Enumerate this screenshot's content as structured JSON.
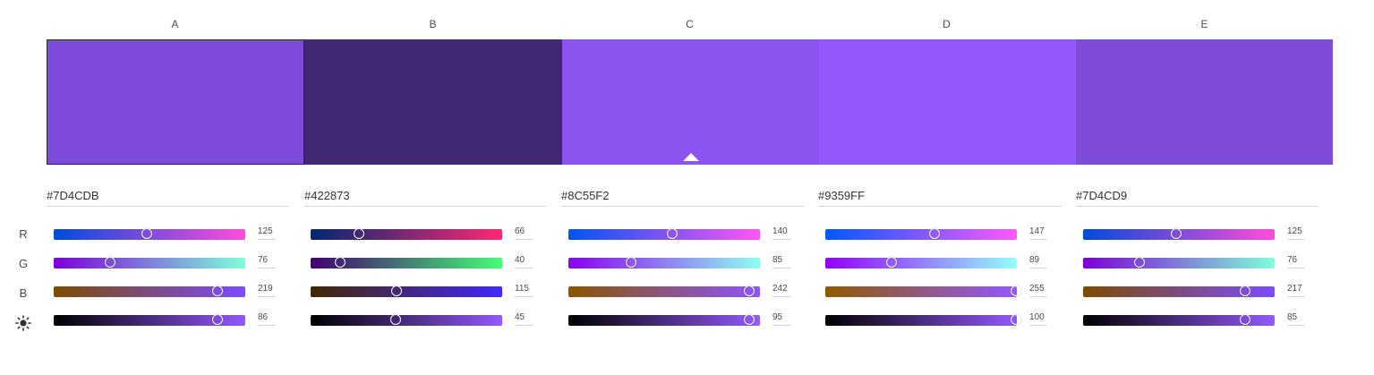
{
  "rows": {
    "r": "R",
    "g": "G",
    "b": "B",
    "brightness_icon": "sun-icon"
  },
  "columns": [
    {
      "letter": "A",
      "hex": "#7D4CDB",
      "color": "#7D4CDB",
      "selected": true,
      "r": 125,
      "g": 76,
      "b": 219,
      "brightness": 86
    },
    {
      "letter": "B",
      "hex": "#422873",
      "color": "#422873",
      "selected": false,
      "r": 66,
      "g": 40,
      "b": 115,
      "brightness": 45
    },
    {
      "letter": "C",
      "hex": "#8C55F2",
      "color": "#8C55F2",
      "selected": false,
      "base": true,
      "r": 140,
      "g": 85,
      "b": 242,
      "brightness": 95
    },
    {
      "letter": "D",
      "hex": "#9359FF",
      "color": "#9359FF",
      "selected": false,
      "r": 147,
      "g": 89,
      "b": 255,
      "brightness": 100
    },
    {
      "letter": "E",
      "hex": "#7D4CD9",
      "color": "#7D4CD9",
      "selected": false,
      "r": 125,
      "g": 76,
      "b": 217,
      "brightness": 85
    }
  ]
}
